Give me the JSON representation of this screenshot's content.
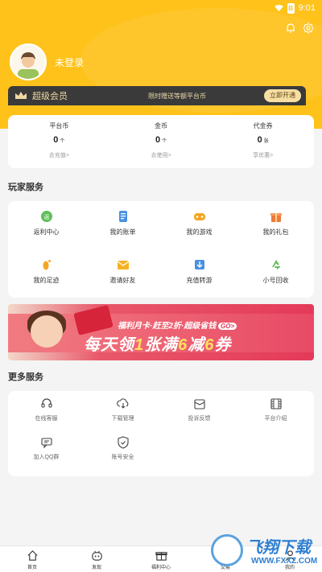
{
  "status_bar": {
    "time": "9:01",
    "battery_label": "B"
  },
  "profile": {
    "login_text": "未登录"
  },
  "vip": {
    "title": "超级会员",
    "desc": "限时赠送等额平台币",
    "button": "立即开通"
  },
  "wallet": [
    {
      "name": "平台币",
      "value": "0",
      "unit": "个",
      "link": "去充值>"
    },
    {
      "name": "金币",
      "value": "0",
      "unit": "个",
      "link": "去使用>"
    },
    {
      "name": "代金券",
      "value": "0",
      "unit": "张",
      "link": "享优惠>"
    }
  ],
  "player_services": {
    "title": "玩家服务",
    "items": [
      {
        "label": "返利中心",
        "icon": "rebate-icon"
      },
      {
        "label": "我的账单",
        "icon": "bill-icon"
      },
      {
        "label": "我的游戏",
        "icon": "game-icon"
      },
      {
        "label": "我的礼包",
        "icon": "gift-icon"
      },
      {
        "label": "我的足迹",
        "icon": "footprint-icon"
      },
      {
        "label": "邀请好友",
        "icon": "invite-icon"
      },
      {
        "label": "充值转游",
        "icon": "transfer-icon"
      },
      {
        "label": "小号回收",
        "icon": "recycle-icon"
      }
    ]
  },
  "banner": {
    "top_line": "福利月卡·赶至2折·超级省钱",
    "pill": "GO>",
    "main_prefix": "每天领",
    "main_num1": "1",
    "main_mid": "张满",
    "main_num2": "6",
    "main_mid2": "减",
    "main_num3": "6",
    "main_suffix": "券"
  },
  "more_services": {
    "title": "更多服务",
    "items": [
      {
        "label": "在线客服",
        "icon": "headset-icon"
      },
      {
        "label": "下载管理",
        "icon": "download-icon"
      },
      {
        "label": "投诉反馈",
        "icon": "feedback-icon"
      },
      {
        "label": "平台介绍",
        "icon": "film-icon"
      },
      {
        "label": "加入QQ群",
        "icon": "chat-icon"
      },
      {
        "label": "账号安全",
        "icon": "shield-icon"
      }
    ]
  },
  "bottom_nav": [
    {
      "label": "首页",
      "icon": "home-icon"
    },
    {
      "label": "发现",
      "icon": "robot-icon"
    },
    {
      "label": "福利中心",
      "icon": "gift-box-icon"
    },
    {
      "label": "交易",
      "icon": "trade-icon"
    },
    {
      "label": "我的",
      "icon": "user-icon"
    }
  ],
  "watermark": {
    "title": "飞翔下载",
    "url": "WWW.FXXZ.COM"
  },
  "colors": {
    "brand": "#ffc21a",
    "vip_bar": "#3a3a3a",
    "vip_text": "#f0d9a0",
    "banner": "#e43a59"
  }
}
